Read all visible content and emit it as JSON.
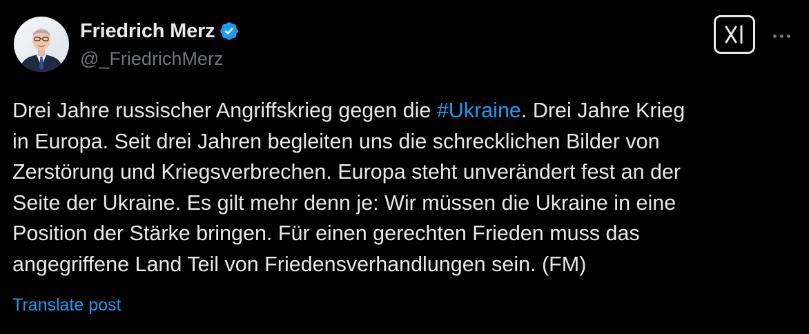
{
  "author": {
    "display_name": "Friedrich Merz",
    "handle": "@_FriedrichMerz",
    "verified": true,
    "avatar_icon": "profile-photo"
  },
  "actions": {
    "grok_icon": "grok-icon",
    "more_icon": "more-options-icon"
  },
  "post": {
    "lines": [
      [
        "Drei Jahre russischer Angriffskrieg gegen die ",
        "#Ukraine",
        ". Drei Jahre Krieg"
      ],
      [
        "in Europa. Seit drei Jahren begleiten uns die schrecklichen Bilder von"
      ],
      [
        "Zerstörung und Kriegsverbrechen. Europa steht unverändert fest an der"
      ],
      [
        "Seite der Ukraine. Es gilt mehr denn je: Wir müssen die Ukraine in eine"
      ],
      [
        "Position der Stärke bringen. Für einen gerechten Frieden muss das"
      ],
      [
        "angegriffene Land Teil von Friedensverhandlungen sein. (FM)"
      ]
    ],
    "translate_label": "Translate post"
  },
  "colors": {
    "background": "#000000",
    "text": "#e7e9ea",
    "secondary_text": "#71767b",
    "link": "#1d9bf0",
    "verified_badge": "#1d9bf0"
  }
}
